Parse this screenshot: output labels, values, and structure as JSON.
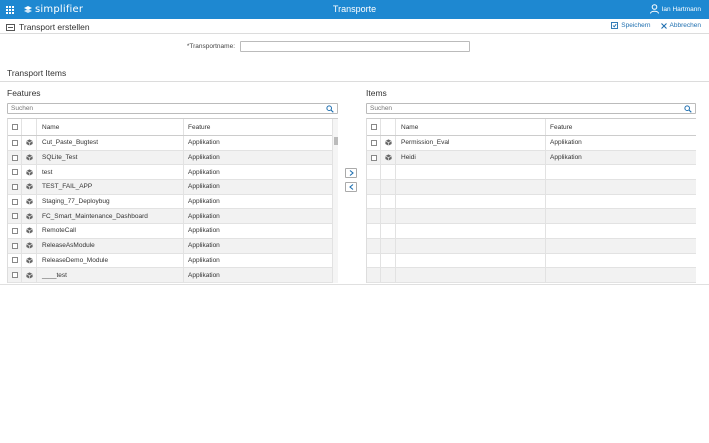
{
  "topbar": {
    "logo_text": "simplifier",
    "app_title": "Transporte",
    "user_name": "Ian Hartmann"
  },
  "toolbar": {
    "title": "Transport erstellen",
    "save_label": "Speichern",
    "cancel_label": "Abbrechen"
  },
  "form": {
    "transport_name_label": "*Transportname:",
    "transport_name_value": ""
  },
  "section_title": "Transport Items",
  "features": {
    "title": "Features",
    "search_placeholder": "Suchen",
    "columns": {
      "name": "Name",
      "feature": "Feature"
    },
    "rows": [
      {
        "name": "Cut_Paste_Bugtest",
        "feature": "Applikation"
      },
      {
        "name": "SQLite_Test",
        "feature": "Applikation"
      },
      {
        "name": "test",
        "feature": "Applikation"
      },
      {
        "name": "TEST_FAIL_APP",
        "feature": "Applikation"
      },
      {
        "name": "Staging_77_Deploybug",
        "feature": "Applikation"
      },
      {
        "name": "FC_Smart_Maintenance_Dashboard",
        "feature": "Applikation"
      },
      {
        "name": "RemoteCall",
        "feature": "Applikation"
      },
      {
        "name": "ReleaseAsModule",
        "feature": "Applikation"
      },
      {
        "name": "ReleaseDemo_Module",
        "feature": "Applikation"
      },
      {
        "name": "____test",
        "feature": "Applikation"
      }
    ]
  },
  "items": {
    "title": "Items",
    "search_placeholder": "Suchen",
    "columns": {
      "name": "Name",
      "feature": "Feature"
    },
    "rows": [
      {
        "name": "Permission_Eval",
        "feature": "Applikation"
      },
      {
        "name": "Heidi",
        "feature": "Applikation"
      }
    ],
    "empty_rows": 8
  },
  "colors": {
    "topbar": "#1e88d1",
    "accent_text": "#1e6fb0"
  },
  "icons": {
    "apps": "grid-icon",
    "logo": "simplifier-logo-icon",
    "user": "user-icon",
    "transport": "transport-icon",
    "save": "save-icon",
    "cancel": "close-icon",
    "search": "search-icon",
    "row": "cube-icon",
    "move_right": "chevron-right-icon",
    "move_left": "chevron-left-icon"
  }
}
